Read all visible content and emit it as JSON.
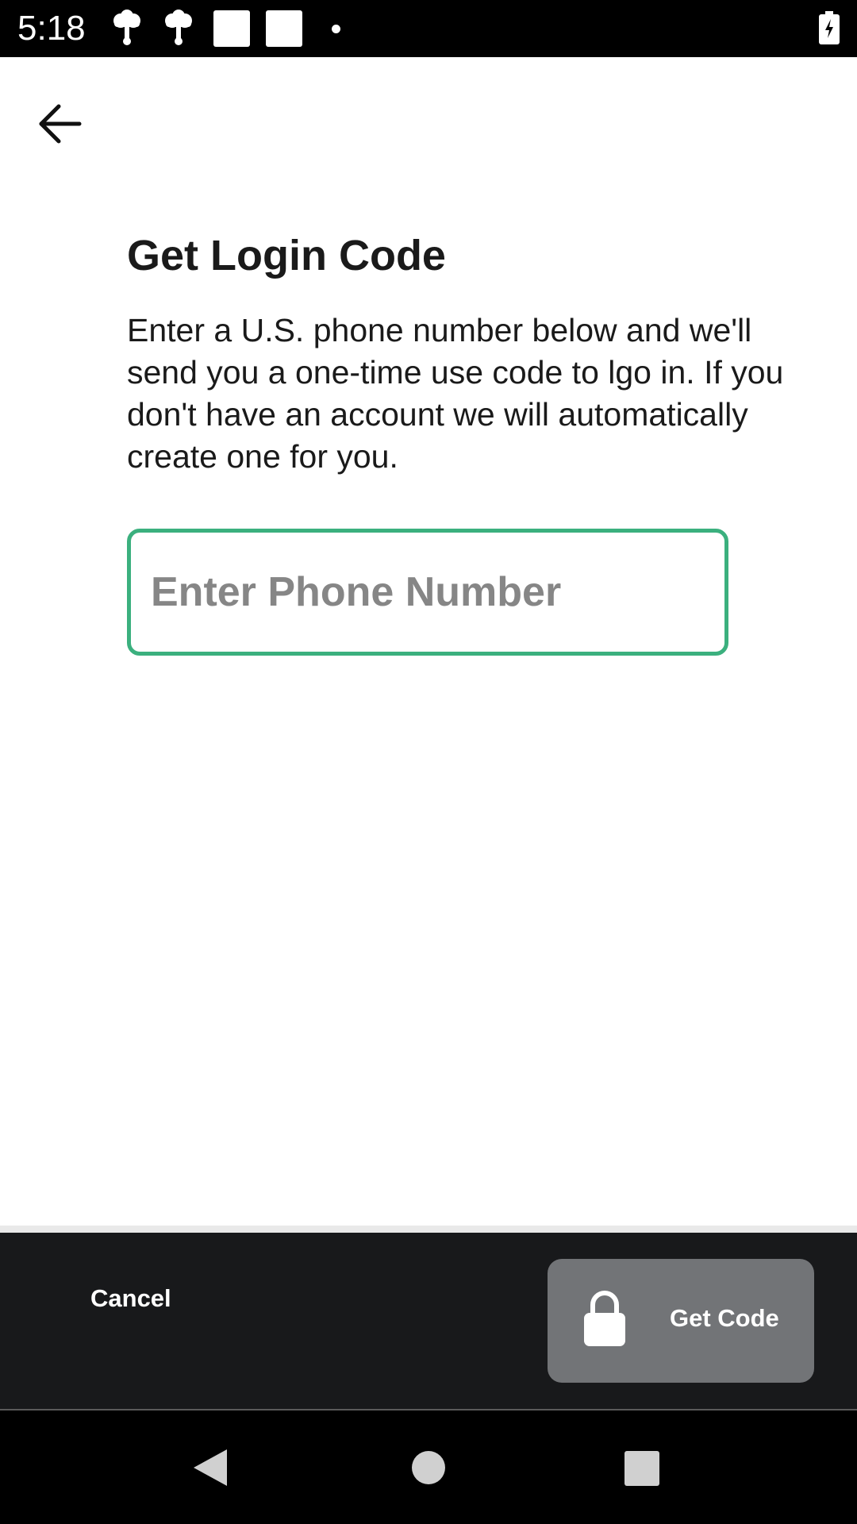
{
  "status_bar": {
    "time": "5:18",
    "icons": [
      "notification-icon",
      "notification-icon",
      "app-icon",
      "app-icon",
      "dot-icon",
      "battery-charging-icon"
    ]
  },
  "header": {
    "back_icon": "arrow-left-icon"
  },
  "main": {
    "title": "Get Login Code",
    "description": "Enter a U.S. phone number below and we'll send you a one-time use code to lgo in. If you don't have an account we will automatically create one for you.",
    "phone_input": {
      "value": "",
      "placeholder": "Enter Phone Number"
    }
  },
  "action_bar": {
    "cancel_label": "Cancel",
    "get_code_label": "Get Code",
    "get_code_icon": "lock-icon"
  },
  "nav_bar": {
    "icons": [
      "back-triangle-icon",
      "home-circle-icon",
      "recents-square-icon"
    ]
  },
  "colors": {
    "accent": "#3bb07e",
    "action_bar_bg": "#18191b",
    "button_bg": "#727477",
    "placeholder": "#868686",
    "text": "#1a1a1a"
  }
}
